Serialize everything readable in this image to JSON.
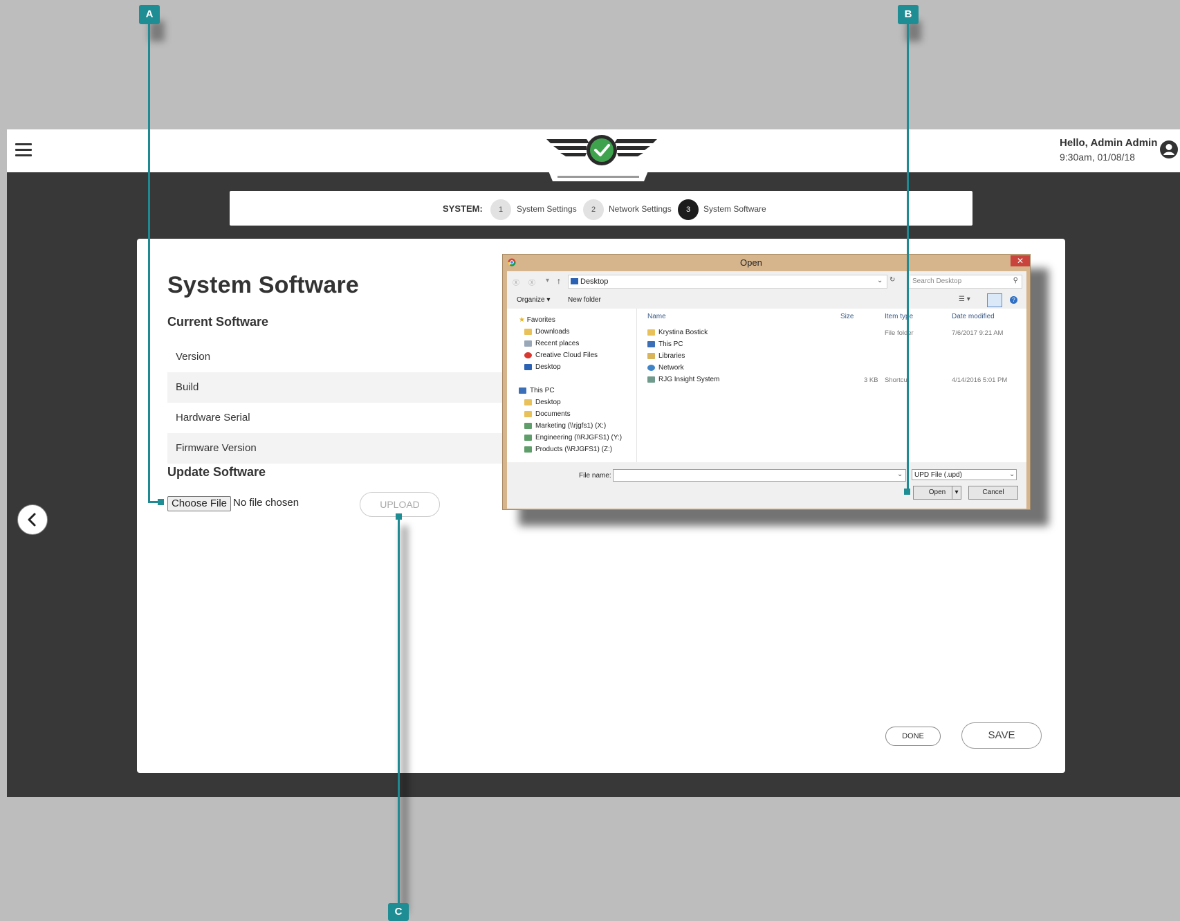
{
  "header": {
    "greeting": "Hello, Admin Admin",
    "datetime": "9:30am, 01/08/18"
  },
  "stepper": {
    "label": "SYSTEM:",
    "steps": [
      {
        "number": "1",
        "label": "System Settings"
      },
      {
        "number": "2",
        "label": "Network Settings"
      },
      {
        "number": "3",
        "label": "System Software",
        "active": true
      }
    ]
  },
  "page": {
    "title": "System Software",
    "current_heading": "Current Software",
    "rows": [
      {
        "label": "Version"
      },
      {
        "label": "Build"
      },
      {
        "label": "Hardware Serial"
      },
      {
        "label": "Firmware Version"
      }
    ],
    "update_heading": "Update Software",
    "choose_file_label": "Choose File",
    "no_file_text": "No file chosen",
    "upload_label": "UPLOAD",
    "done_label": "DONE",
    "save_label": "SAVE"
  },
  "dialog": {
    "title": "Open",
    "close_glyph": "✕",
    "address": "Desktop",
    "search_placeholder": "Search Desktop",
    "organize_label": "Organize ▾",
    "new_folder_label": "New folder",
    "nav": {
      "favorites_label": "Favorites",
      "favorites": [
        "Downloads",
        "Recent places",
        "Creative Cloud Files",
        "Desktop"
      ],
      "thispc_label": "This PC",
      "thispc": [
        "Desktop",
        "Documents",
        "Marketing (\\\\rjgfs1) (X:)",
        "Engineering (\\\\RJGFS1) (Y:)",
        "Products (\\\\RJGFS1) (Z:)"
      ]
    },
    "columns": {
      "name": "Name",
      "size": "Size",
      "type": "Item type",
      "date": "Date modified"
    },
    "files": [
      {
        "name": "Krystina Bostick",
        "size": "",
        "type": "File folder",
        "date": "7/6/2017 9:21 AM"
      },
      {
        "name": "This PC",
        "size": "",
        "type": "",
        "date": ""
      },
      {
        "name": "Libraries",
        "size": "",
        "type": "",
        "date": ""
      },
      {
        "name": "Network",
        "size": "",
        "type": "",
        "date": ""
      },
      {
        "name": "RJG Insight System",
        "size": "3 KB",
        "type": "Shortcut",
        "date": "4/14/2016 5:01 PM"
      }
    ],
    "filename_label": "File name:",
    "filename_value": "",
    "filetype": "UPD File (.upd)",
    "open_label": "Open",
    "cancel_label": "Cancel"
  },
  "callouts": {
    "a": "A",
    "b": "B",
    "c": "C"
  },
  "colors": {
    "accent": "#1f8d94",
    "logo_green": "#3fa34d",
    "dark_bg": "#383838"
  }
}
